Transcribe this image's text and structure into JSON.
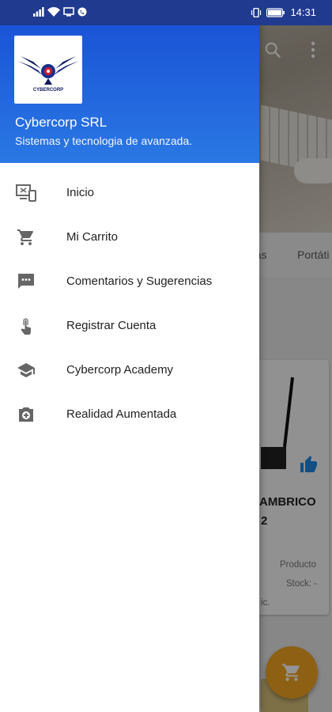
{
  "status_bar": {
    "time": "14:31"
  },
  "drawer": {
    "header": {
      "logo_text": "CYBERCORP",
      "title": "Cybercorp SRL",
      "subtitle": "Sistemas y tecnologia de avanzada."
    },
    "items": [
      {
        "label": "Inicio",
        "icon": "devices-icon"
      },
      {
        "label": "Mi Carrito",
        "icon": "cart-icon"
      },
      {
        "label": "Comentarios y Sugerencias",
        "icon": "comment-icon"
      },
      {
        "label": "Registrar Cuenta",
        "icon": "touch-icon"
      },
      {
        "label": "Cybercorp Academy",
        "icon": "school-icon"
      },
      {
        "label": "Realidad Aumentada",
        "icon": "camera-plus-icon"
      }
    ]
  },
  "background_app": {
    "tabs": [
      "ras",
      "Portáti"
    ],
    "product_title_lines": [
      "AMBRICO",
      "2"
    ],
    "product_type": "Producto",
    "stock": "Stock: -",
    "truncated_text": "ic."
  },
  "colors": {
    "header_start": "#1a54d6",
    "header_end": "#2a78e4",
    "status_bar": "#1f3a8f",
    "fab": "#f5a623",
    "like_icon": "#1e88e5",
    "menu_icon": "#666666"
  }
}
